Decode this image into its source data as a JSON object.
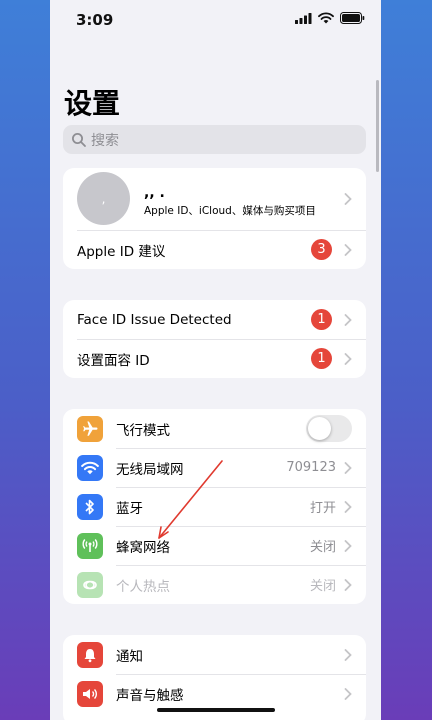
{
  "status": {
    "time": "3:09"
  },
  "page": {
    "title": "设置"
  },
  "search": {
    "placeholder": "搜索"
  },
  "profile": {
    "avatar_text": ",",
    "name": ",, .",
    "subtitle": "Apple ID、iCloud、媒体与购买项目",
    "suggestion_label": "Apple ID 建议",
    "suggestion_badge": "3"
  },
  "alerts": [
    {
      "label": "Face ID Issue Detected",
      "badge": "1"
    },
    {
      "label": "设置面容 ID",
      "badge": "1"
    }
  ],
  "connectivity": [
    {
      "label": "飞行模式",
      "icon": "airplane-icon",
      "color": "#f0a23a",
      "toggle": false
    },
    {
      "label": "无线局域网",
      "icon": "wifi-icon",
      "color": "#3478f6",
      "value": "709123"
    },
    {
      "label": "蓝牙",
      "icon": "bluetooth-icon",
      "color": "#3478f6",
      "value": "打开"
    },
    {
      "label": "蜂窝网络",
      "icon": "antenna-icon",
      "color": "#5fc05a",
      "value": "关闭"
    },
    {
      "label": "个人热点",
      "icon": "hotspot-icon",
      "color": "#5fc05a",
      "value": "关闭",
      "disabled": true
    }
  ],
  "notifications": [
    {
      "label": "通知",
      "icon": "bell-icon",
      "color": "#e5463a"
    },
    {
      "label": "声音与触感",
      "icon": "speaker-icon",
      "color": "#e5463a"
    }
  ]
}
